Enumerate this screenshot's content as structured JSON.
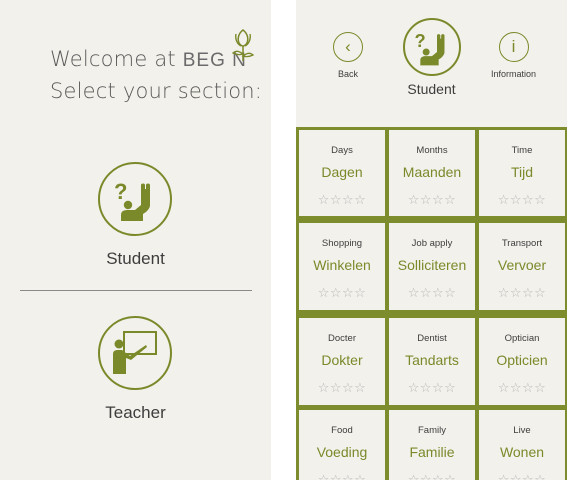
{
  "left": {
    "welcome_line1": "Welcome at",
    "brand": "BEG  N",
    "welcome_line2": "Select your section:",
    "student_label": "Student",
    "teacher_label": "Teacher"
  },
  "right": {
    "back_label": "Back",
    "info_label": "Information",
    "info_glyph": "i",
    "back_glyph": "‹",
    "section_title": "Student",
    "star_rating": "☆☆☆☆",
    "categories": [
      {
        "en": "Days",
        "nl": "Dagen",
        "stars": 0
      },
      {
        "en": "Months",
        "nl": "Maanden",
        "stars": 0
      },
      {
        "en": "Time",
        "nl": "Tijd",
        "stars": 0
      },
      {
        "en": "Shopping",
        "nl": "Winkelen",
        "stars": 0
      },
      {
        "en": "Job apply",
        "nl": "Solliciteren",
        "stars": 0
      },
      {
        "en": "Transport",
        "nl": "Vervoer",
        "stars": 0
      },
      {
        "en": "Docter",
        "nl": "Dokter",
        "stars": 0
      },
      {
        "en": "Dentist",
        "nl": "Tandarts",
        "stars": 0
      },
      {
        "en": "Optician",
        "nl": "Opticien",
        "stars": 0
      },
      {
        "en": "Food",
        "nl": "Voeding",
        "stars": 0
      },
      {
        "en": "Family",
        "nl": "Familie",
        "stars": 0
      },
      {
        "en": "Live",
        "nl": "Wonen",
        "stars": 0
      }
    ]
  },
  "colors": {
    "accent": "#7a8a2a",
    "panel_bg": "#f3f1ec",
    "grid_bg": "#7d8c2d",
    "star_empty": "#b8b8b8"
  }
}
